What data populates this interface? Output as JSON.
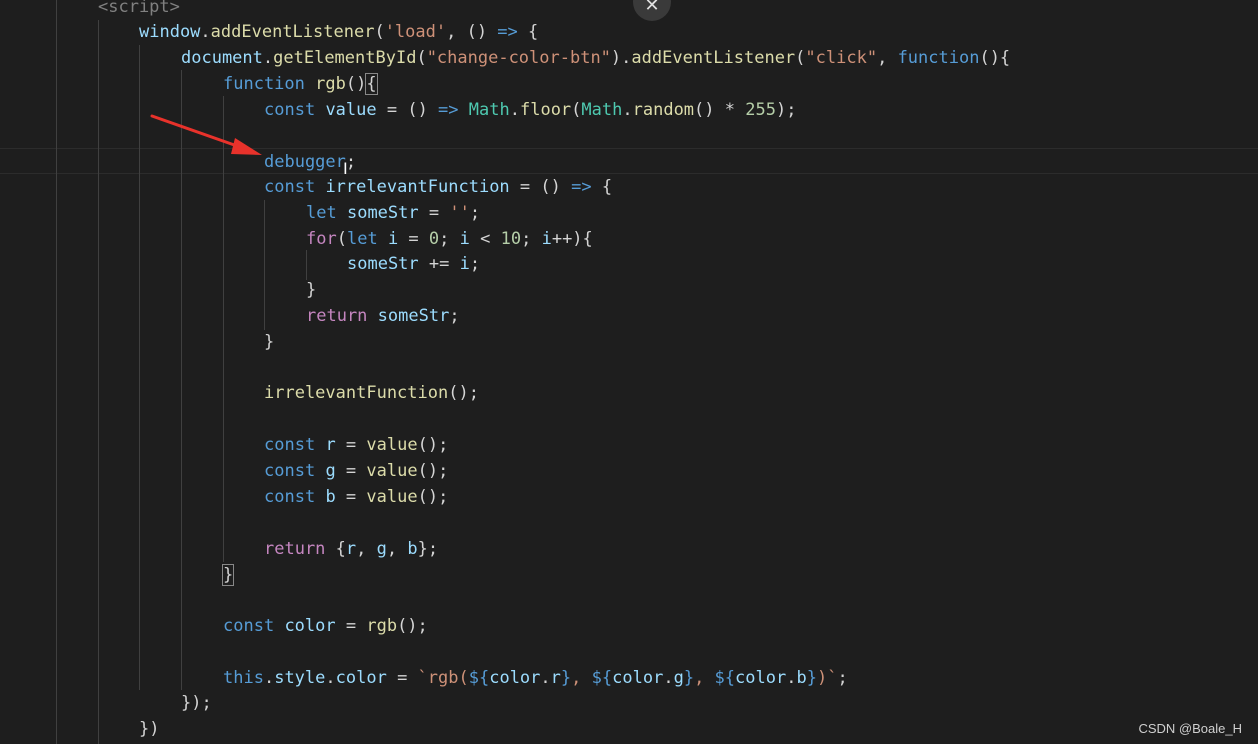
{
  "editor": {
    "lines": {
      "l0": [
        "<script>"
      ],
      "l1": [
        "window",
        ".",
        "addEventListener",
        "(",
        "'load'",
        ", () ",
        "=>",
        " {"
      ],
      "l2": [
        "document",
        ".",
        "getElementById",
        "(",
        "\"change-color-btn\"",
        ").",
        "addEventListener",
        "(",
        "\"click\"",
        ", ",
        "function",
        "(){"
      ],
      "l3": [
        "function",
        " ",
        "rgb",
        "()",
        "{"
      ],
      "l4": [
        "const",
        " ",
        "value",
        " = () ",
        "=>",
        " ",
        "Math",
        ".",
        "floor",
        "(",
        "Math",
        ".",
        "random",
        "() * ",
        "255",
        ");"
      ],
      "l6": [
        "debugger",
        ";"
      ],
      "l7": [
        "const",
        " ",
        "irrelevantFunction",
        " = () ",
        "=>",
        " {"
      ],
      "l8": [
        "let",
        " ",
        "someStr",
        " = ",
        "''",
        ";"
      ],
      "l9": [
        "for",
        "(",
        "let",
        " ",
        "i",
        " = ",
        "0",
        "; ",
        "i",
        " < ",
        "10",
        "; ",
        "i",
        "++){"
      ],
      "l10": [
        "someStr",
        " += ",
        "i",
        ";"
      ],
      "l11": [
        "}"
      ],
      "l12": [
        "return",
        " ",
        "someStr",
        ";"
      ],
      "l13": [
        "}"
      ],
      "l15": [
        "irrelevantFunction",
        "();"
      ],
      "l17": [
        "const",
        " ",
        "r",
        " = ",
        "value",
        "();"
      ],
      "l18": [
        "const",
        " ",
        "g",
        " = ",
        "value",
        "();"
      ],
      "l19": [
        "const",
        " ",
        "b",
        " = ",
        "value",
        "();"
      ],
      "l21": [
        "return",
        " {",
        "r",
        ", ",
        "g",
        ", ",
        "b",
        "};"
      ],
      "l22": [
        "}"
      ],
      "l24": [
        "const",
        " ",
        "color",
        " = ",
        "rgb",
        "();"
      ],
      "l26": [
        "this",
        ".",
        "style",
        ".",
        "color",
        " = ",
        "`rgb(",
        "${",
        "color",
        ".",
        "r",
        "}",
        ", ",
        "${",
        "color",
        ".",
        "g",
        "}",
        ", ",
        "${",
        "color",
        ".",
        "b",
        "}",
        ")`",
        ";"
      ],
      "l27": [
        "});"
      ],
      "l28": [
        "})"
      ]
    }
  },
  "close_button": {
    "glyph": "✕"
  },
  "cursor": {
    "glyph": "I"
  },
  "watermark": {
    "text": "CSDN @Boale_H"
  },
  "colors": {
    "background": "#1e1e1e",
    "keyword": "#569cd6",
    "control": "#c586c0",
    "function": "#dcdcaa",
    "variable": "#9cdcfe",
    "class": "#4ec9b0",
    "string": "#ce9178",
    "number": "#b5cea8",
    "annotation_arrow": "#e8322b"
  }
}
